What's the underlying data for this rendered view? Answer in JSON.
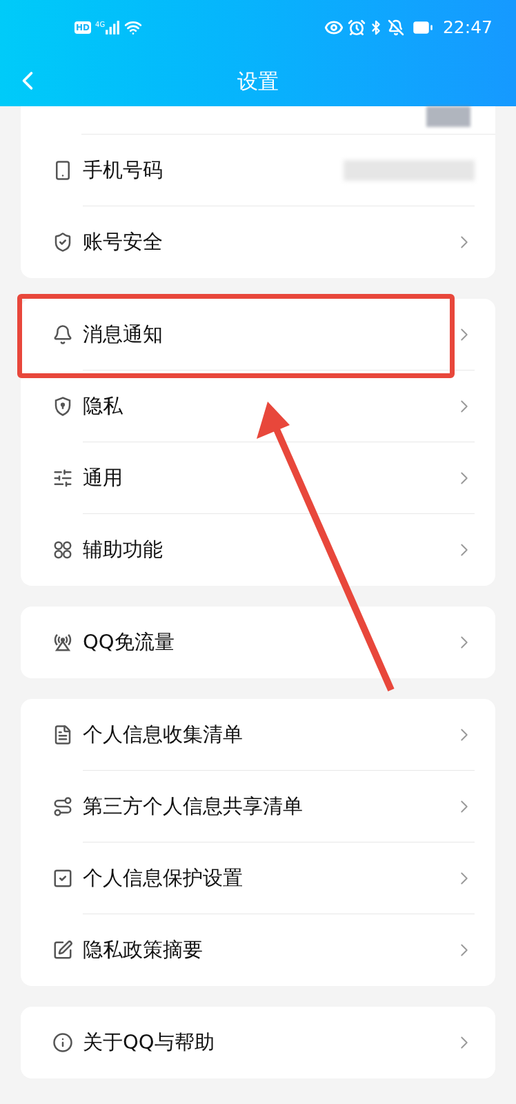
{
  "status_bar": {
    "badge": "HD",
    "network": "4G",
    "time": "22:47"
  },
  "header": {
    "title": "设置"
  },
  "sections": [
    {
      "rows": [
        {
          "kind": "cut"
        },
        {
          "kind": "redacted",
          "label": "手机号码",
          "chevron": false
        },
        {
          "kind": "plain",
          "label": "账号安全",
          "chevron": true
        }
      ]
    },
    {
      "rows": [
        {
          "kind": "plain",
          "label": "消息通知",
          "chevron": true
        },
        {
          "kind": "plain",
          "label": "隐私",
          "chevron": true
        },
        {
          "kind": "plain",
          "label": "通用",
          "chevron": true
        },
        {
          "kind": "plain",
          "label": "辅助功能",
          "chevron": true
        }
      ]
    },
    {
      "rows": [
        {
          "kind": "plain",
          "label": "QQ免流量",
          "chevron": true
        }
      ]
    },
    {
      "rows": [
        {
          "kind": "plain",
          "label": "个人信息收集清单",
          "chevron": true
        },
        {
          "kind": "plain",
          "label": "第三方个人信息共享清单",
          "chevron": true
        },
        {
          "kind": "plain",
          "label": "个人信息保护设置",
          "chevron": true
        },
        {
          "kind": "plain",
          "label": "隐私政策摘要",
          "chevron": true
        }
      ]
    },
    {
      "rows": [
        {
          "kind": "plain",
          "label": "关于QQ与帮助",
          "chevron": true
        }
      ]
    }
  ]
}
